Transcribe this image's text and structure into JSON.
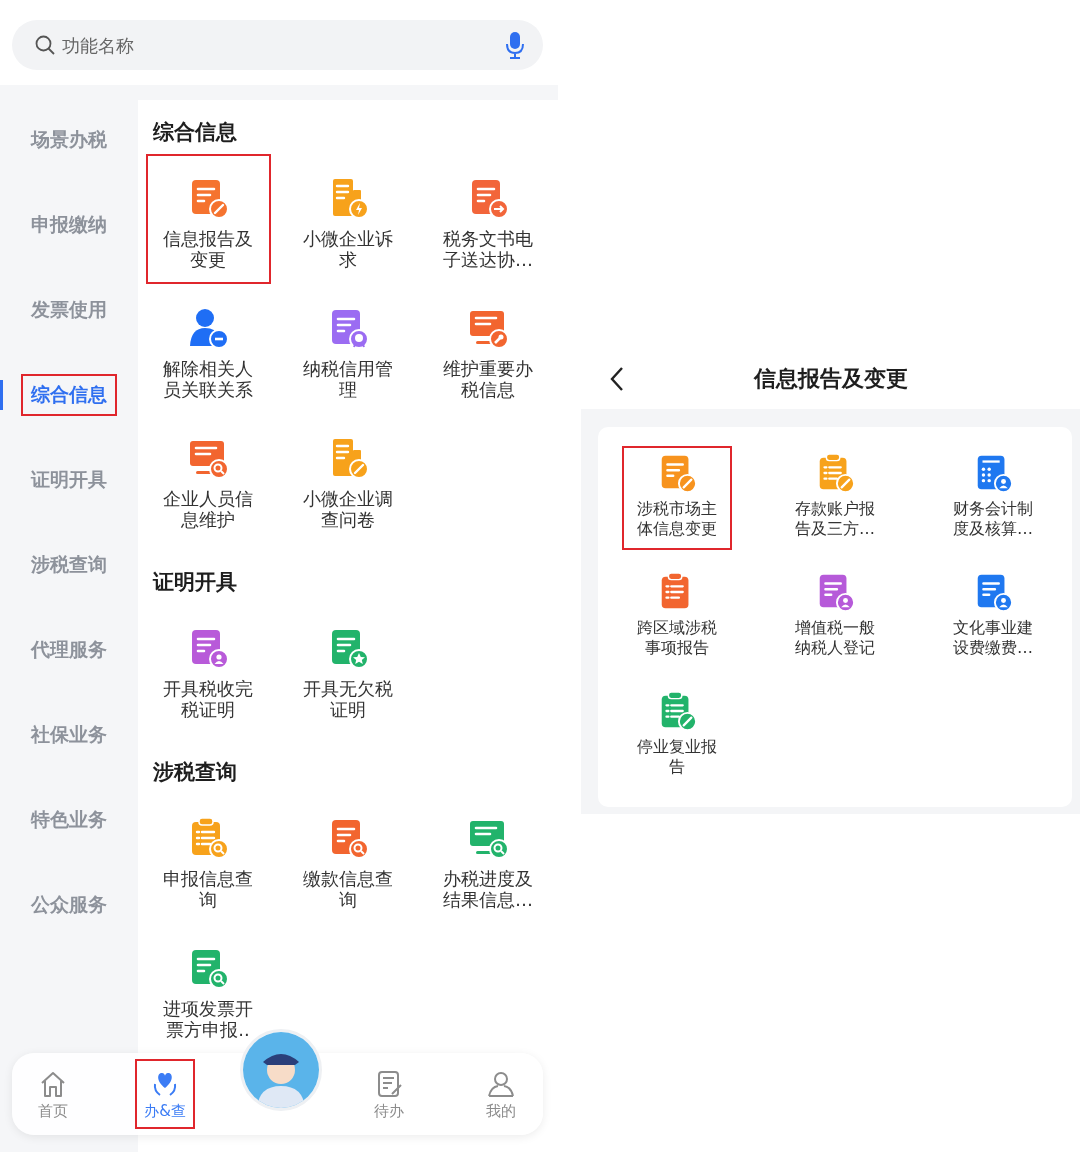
{
  "search": {
    "placeholder": "功能名称"
  },
  "sidebar": [
    {
      "label": "场景办税",
      "selected": false,
      "highlighted": false
    },
    {
      "label": "申报缴纳",
      "selected": false,
      "highlighted": false
    },
    {
      "label": "发票使用",
      "selected": false,
      "highlighted": false
    },
    {
      "label": "综合信息",
      "selected": true,
      "highlighted": true
    },
    {
      "label": "证明开具",
      "selected": false,
      "highlighted": false
    },
    {
      "label": "涉税查询",
      "selected": false,
      "highlighted": false
    },
    {
      "label": "代理服务",
      "selected": false,
      "highlighted": false
    },
    {
      "label": "社保业务",
      "selected": false,
      "highlighted": false
    },
    {
      "label": "特色业务",
      "selected": false,
      "highlighted": false
    },
    {
      "label": "公众服务",
      "selected": false,
      "highlighted": false
    }
  ],
  "sections": [
    {
      "title": "综合信息",
      "items": [
        {
          "label": "信息报告及变更",
          "kind": "doc_pencil",
          "color": "#f5732f",
          "highlighted": true
        },
        {
          "label": "小微企业诉求",
          "kind": "building_bolt",
          "color": "#f7a21b",
          "highlighted": false
        },
        {
          "label": "税务文书电子送达协…",
          "kind": "doc_arrow",
          "color": "#f2653a",
          "highlighted": false
        },
        {
          "label": "解除相关人员关联关系",
          "kind": "person_minus",
          "color": "#1f6ef5",
          "highlighted": false
        },
        {
          "label": "纳税信用管理",
          "kind": "doc_award",
          "color": "#9b6cf2",
          "highlighted": false
        },
        {
          "label": "维护重要办税信息",
          "kind": "card_wrench",
          "color": "#f2652f",
          "highlighted": false
        },
        {
          "label": "企业人员信息维护",
          "kind": "card_search",
          "color": "#f2652f",
          "highlighted": false
        },
        {
          "label": "小微企业调查问卷",
          "kind": "building_pencil",
          "color": "#f7a21b",
          "highlighted": false
        }
      ]
    },
    {
      "title": "证明开具",
      "items": [
        {
          "label": "开具税收完税证明",
          "kind": "doc_user",
          "color": "#b85ad9",
          "highlighted": false
        },
        {
          "label": "开具无欠税证明",
          "kind": "doc_star",
          "color": "#22b36b",
          "highlighted": false
        }
      ]
    },
    {
      "title": "涉税查询",
      "items": [
        {
          "label": "申报信息查询",
          "kind": "clipboard_search",
          "color": "#f7a21b",
          "highlighted": false
        },
        {
          "label": "缴款信息查询",
          "kind": "doc_search",
          "color": "#f2652f",
          "highlighted": false
        },
        {
          "label": "办税进度及结果信息…",
          "kind": "card_search",
          "color": "#22b36b",
          "highlighted": false
        },
        {
          "label": "进项发票开票方申报..",
          "kind": "doc_search",
          "color": "#22b36b",
          "highlighted": false
        }
      ]
    }
  ],
  "nav": [
    {
      "label": "首页",
      "kind": "home",
      "selected": false,
      "highlighted": false
    },
    {
      "label": "办&查",
      "kind": "care",
      "selected": true,
      "highlighted": true
    },
    {
      "label": "待办",
      "kind": "todo",
      "selected": false,
      "highlighted": false
    },
    {
      "label": "我的",
      "kind": "user",
      "selected": false,
      "highlighted": false
    }
  ],
  "detail": {
    "title": "信息报告及变更",
    "items": [
      {
        "label": "涉税市场主体信息变更",
        "kind": "doc_pencil",
        "color": "#f7931e",
        "highlighted": true
      },
      {
        "label": "存款账户报告及三方…",
        "kind": "clipboard_pencil",
        "color": "#f7a21b",
        "highlighted": false
      },
      {
        "label": "财务会计制度及核算…",
        "kind": "grid_user",
        "color": "#1f78f0",
        "highlighted": false
      },
      {
        "label": "跨区域涉税事项报告",
        "kind": "clipboard_none",
        "color": "#f2652f",
        "highlighted": false
      },
      {
        "label": "增值税一般纳税人登记",
        "kind": "doc_user",
        "color": "#b65ad9",
        "highlighted": false
      },
      {
        "label": "文化事业建设费缴费…",
        "kind": "doc_user",
        "color": "#1f78f0",
        "highlighted": false
      },
      {
        "label": "停业复业报告",
        "kind": "clipboard_pencil",
        "color": "#22b36b",
        "highlighted": false
      }
    ]
  }
}
